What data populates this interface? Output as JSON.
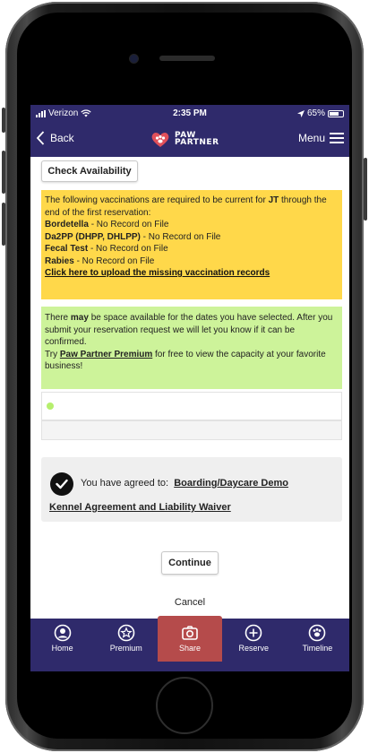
{
  "status_bar": {
    "carrier": "Verizon",
    "time": "2:35 PM",
    "battery": "65%"
  },
  "nav": {
    "back_label": "Back",
    "logo_line1": "PAW",
    "logo_line2": "PARTNER",
    "menu_label": "Menu"
  },
  "check_availability_label": "Check Availability",
  "vaccinations": {
    "intro_prefix": "The following vaccinations are required to be current for",
    "pet_name": "JT",
    "intro_suffix": "through the end of the first reservation:",
    "items": [
      {
        "name": "Bordetella",
        "status": "- No Record on File"
      },
      {
        "name": "Da2PP (DHPP, DHLPP)",
        "status": "- No Record on File"
      },
      {
        "name": "Fecal Test",
        "status": "- No Record on File"
      },
      {
        "name": "Rabies",
        "status": "- No Record on File"
      }
    ],
    "upload_link": "Click here to upload the missing vaccination records"
  },
  "availability": {
    "text1": "There",
    "emphasis": "may",
    "text2": "be space available for the dates you have selected. After you submit your reservation request we will let you know if it can be confirmed.",
    "try_prefix": "Try",
    "premium_link": "Paw Partner Premium",
    "try_suffix": "for free to view the capacity at your favorite business!"
  },
  "agreement": {
    "prefix": "You have agreed to:",
    "link_line1": "Boarding/Daycare Demo",
    "link_line2": "Kennel Agreement and Liability Waiver"
  },
  "continue_label": "Continue",
  "cancel_label": "Cancel",
  "tabs": [
    {
      "label": "Home",
      "icon": "user-circle-icon"
    },
    {
      "label": "Premium",
      "icon": "star-badge-icon"
    },
    {
      "label": "Share",
      "icon": "camera-icon",
      "active": true
    },
    {
      "label": "Reserve",
      "icon": "plus-circle-icon"
    },
    {
      "label": "Timeline",
      "icon": "paw-circle-icon"
    }
  ],
  "colors": {
    "nav_bg": "#2f2a6b",
    "vaccine_box": "#ffd84a",
    "availability_box": "#cdf39a",
    "active_tab": "#b54b4b",
    "agreement_box": "#efefef"
  }
}
